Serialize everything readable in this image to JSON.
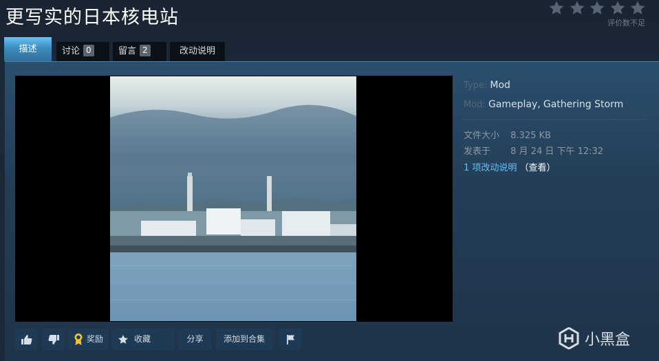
{
  "header": {
    "title": "更写实的日本核电站",
    "rating": {
      "stars_filled": 0,
      "stars_total": 5,
      "note": "评价数不足"
    }
  },
  "tabs": [
    {
      "label": "描述",
      "active": true
    },
    {
      "label": "讨论",
      "count": "0"
    },
    {
      "label": "留言",
      "count": "2"
    },
    {
      "label": "改动说明"
    }
  ],
  "details": {
    "type_label": "Type:",
    "type_value": "Mod",
    "mod_label": "Mod:",
    "mod_value_1": "Gameplay",
    "mod_separator": ",",
    "mod_value_2": "Gathering Storm",
    "size_label": "文件大小",
    "size_value": "8.325 KB",
    "posted_label": "发表于",
    "posted_value": "8 月 24 日 下午 12:32",
    "changes_link": "1 项改动说明",
    "view_link": "（查看）"
  },
  "actions": {
    "award_label": "奖励",
    "favorite_label": "收藏",
    "share_label": "分享",
    "collection_label": "添加到合集"
  },
  "watermark": {
    "text": "小黑盒"
  },
  "colors": {
    "background": "#1b2838",
    "accent": "#66c0f4",
    "tab_active": "#3d8dbe",
    "button": "#1f3a54"
  }
}
